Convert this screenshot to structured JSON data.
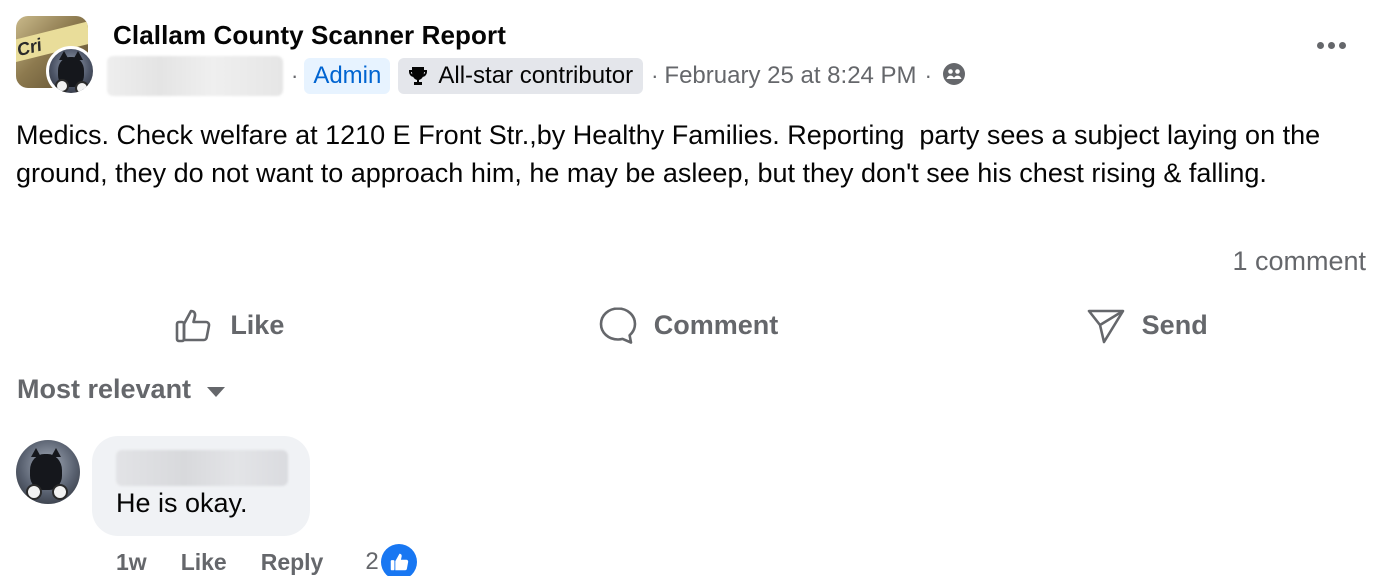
{
  "post": {
    "group_name": "Clallam County Scanner Report",
    "avatar_text": "Cri",
    "admin_badge": "Admin",
    "allstar_badge": "All-star contributor",
    "separator": "·",
    "timestamp": "February 25 at 8:24 PM",
    "body": "Medics. Check welfare at 1210 E Front Str.,by Healthy Families. Reporting  party sees a subject laying on the ground, they do not want to approach him, he may be asleep, but they don't see his chest rising & falling.",
    "comment_count": "1 comment"
  },
  "actions": {
    "like": "Like",
    "comment": "Comment",
    "send": "Send"
  },
  "comments_section": {
    "sort_label": "Most relevant",
    "comments": [
      {
        "text": "He is okay.",
        "age": "1w",
        "like_label": "Like",
        "reply_label": "Reply",
        "reaction_count": "2"
      }
    ]
  },
  "colors": {
    "primary_text": "#050505",
    "secondary_text": "#65676b",
    "accent_blue": "#1877f2",
    "admin_badge_bg": "#e7f3ff",
    "admin_badge_text": "#0064d1",
    "neutral_badge_bg": "#e4e6eb",
    "comment_bubble_bg": "#f0f2f5"
  },
  "icons": {
    "trophy": "trophy-icon",
    "audience": "friends-audience-icon",
    "more": "more-options-icon",
    "like": "thumbs-up-icon",
    "comment": "speech-bubble-icon",
    "send": "send-icon",
    "sort": "caret-down-icon",
    "reaction": "like-reaction-icon"
  }
}
